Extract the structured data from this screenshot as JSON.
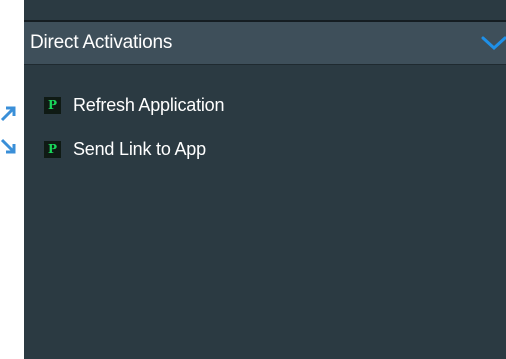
{
  "header": {
    "title": "Direct Activations",
    "toggle_icon": "chevron-down-icon"
  },
  "items": [
    {
      "label": "Refresh Application",
      "icon": "P"
    },
    {
      "label": "Send Link to App",
      "icon": "P"
    }
  ],
  "colors": {
    "panel_bg": "#2b3a42",
    "header_bg": "#3e4f5a",
    "accent": "#1e90e8",
    "icon_letter": "#19d65a"
  }
}
